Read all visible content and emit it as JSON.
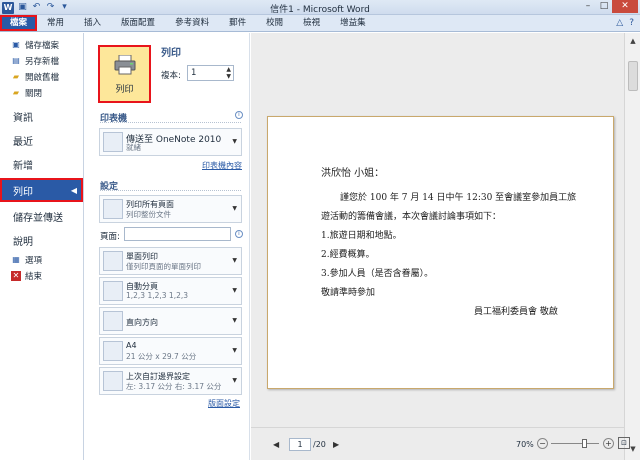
{
  "titlebar": {
    "title": "信件1 - Microsoft Word",
    "logo": "W"
  },
  "tabs": [
    "檔案",
    "常用",
    "插入",
    "版面配置",
    "參考資料",
    "郵件",
    "校閱",
    "檢視",
    "增益集"
  ],
  "leftnav": {
    "small_top": [
      "儲存檔案",
      "另存新檔",
      "開啟舊檔",
      "關閉"
    ],
    "big": [
      "資訊",
      "最近",
      "新增",
      "列印",
      "儲存並傳送",
      "說明"
    ],
    "small_bottom": [
      "選項",
      "結束"
    ],
    "active": "列印"
  },
  "print": {
    "button_label": "列印",
    "heading": "列印",
    "copies_label": "複本:",
    "copies_value": "1"
  },
  "printer": {
    "heading": "印表機",
    "name": "傳送至 OneNote 2010",
    "status": "就緒",
    "properties_link": "印表機內容"
  },
  "settings": {
    "heading": "設定",
    "dropdowns": [
      {
        "line1": "列印所有頁面",
        "line2": "列印整份文件"
      },
      {
        "line1": "單面列印",
        "line2": "僅列印頁面的單面列印"
      },
      {
        "line1": "自動分頁",
        "line2": "1,2,3    1,2,3    1,2,3"
      },
      {
        "line1": "直向方向",
        "line2": ""
      },
      {
        "line1": "A4",
        "line2": "21 公分 x 29.7 公分"
      },
      {
        "line1": "上次自訂邊界設定",
        "line2": "左: 3.17 公分    右: 3.17 公分"
      }
    ],
    "pages_label": "頁面:",
    "page_setup_link": "版面設定"
  },
  "document": {
    "salutation": "洪欣怡 小姐：",
    "line1": "謹您於 100 年 7 月 14 日中午 12:30 至會議室參加員工旅",
    "line2": "遊活動的籌備會議，本次會議討論事項如下：",
    "item1": "1.旅遊日期和地點。",
    "item2": "2.經費概算。",
    "item3": "3.參加人員（是否含眷屬）。",
    "closing": "敬請準時參加",
    "signature": "員工福利委員會 敬啟"
  },
  "pagination": {
    "current": "1",
    "total": "/20"
  },
  "zoom": {
    "level": "70%",
    "fraction": 0.7
  },
  "colors": {
    "accent": "#2a5aa6",
    "highlight": "#e8141b",
    "button_bg": "#fde79a"
  }
}
